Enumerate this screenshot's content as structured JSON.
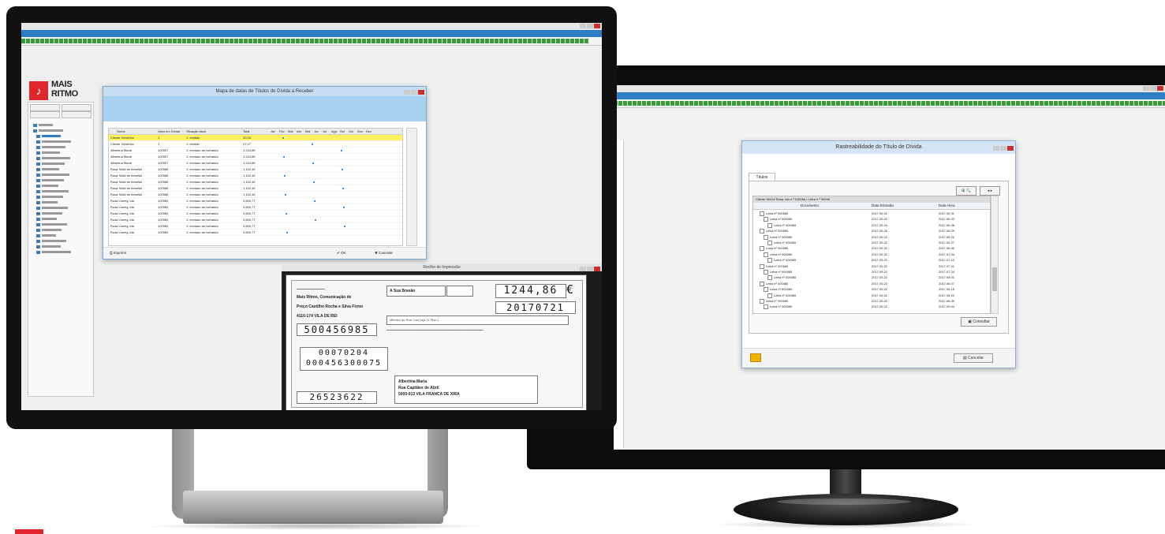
{
  "brand": {
    "logo_line1": "MAIS",
    "logo_line2": "RITMO",
    "accent": "#e0262d",
    "app_blue": "#2f7dc4"
  },
  "left_screen": {
    "grid_dialog": {
      "title": "Mapa de datas de Títulos de Dívida a Receber",
      "columns": [
        "Nome",
        "Valor em Dívida",
        "Situação atual",
        "Total",
        "Jan",
        "Fev",
        "Mar",
        "Abr",
        "Mai",
        "Jun",
        "Jul",
        "Ago",
        "Set",
        "Out",
        "Nov",
        "Dez"
      ],
      "rows": [
        {
          "nome": "Cliente Genérico",
          "valor": "1",
          "situacao": "1. emitido",
          "total": "20,00"
        },
        {
          "nome": "Cliente Genérico",
          "valor": "1",
          "situacao": "1. emitido",
          "total": "27,07"
        },
        {
          "nome": "Albertina Maria",
          "valor": "100957",
          "situacao": "1. enviado ao cobrador",
          "total": "1.244,86"
        },
        {
          "nome": "Albertina Maria",
          "valor": "100957",
          "situacao": "1. enviado ao cobrador",
          "total": "1.244,86"
        },
        {
          "nome": "Albertina Maria",
          "valor": "100957",
          "situacao": "1. enviado ao cobrador",
          "total": "1.244,86"
        },
        {
          "nome": "Rosa Sofia de Almeida",
          "valor": "100968",
          "situacao": "1. enviado ao cobrador",
          "total": "1.152,46"
        },
        {
          "nome": "Rosa Sofia de Almeida",
          "valor": "100968",
          "situacao": "1. enviado ao cobrador",
          "total": "1.152,46"
        },
        {
          "nome": "Rosa Sofia de Almeida",
          "valor": "100968",
          "situacao": "1. enviado ao cobrador",
          "total": "1.152,46"
        },
        {
          "nome": "Rosa Sofia de Almeida",
          "valor": "100968",
          "situacao": "1. enviado ao cobrador",
          "total": "1.152,46"
        },
        {
          "nome": "Rosa Sofia de Almeida",
          "valor": "100968",
          "situacao": "1. enviado ao cobrador",
          "total": "1.152,46"
        },
        {
          "nome": "Rosa Liberty, Ida",
          "valor": "100969",
          "situacao": "1. enviado ao cobrador",
          "total": "3.600,77"
        },
        {
          "nome": "Rosa Liberty, Ida",
          "valor": "100969",
          "situacao": "1. enviado ao cobrador",
          "total": "3.600,77"
        },
        {
          "nome": "Rosa Liberty, Ida",
          "valor": "100969",
          "situacao": "1. enviado ao cobrador",
          "total": "3.600,77"
        },
        {
          "nome": "Rosa Liberty, Ida",
          "valor": "100969",
          "situacao": "1. enviado ao cobrador",
          "total": "3.600,77"
        },
        {
          "nome": "Rosa Liberty, Ida",
          "valor": "100969",
          "situacao": "1. enviado ao cobrador",
          "total": "3.600,77"
        },
        {
          "nome": "Rosa Liberty, Ida",
          "valor": "100969",
          "situacao": "1. enviado ao cobrador",
          "total": "3.600,77"
        }
      ],
      "footer_left": "Imprimir",
      "footer_ok": "OK",
      "footer_cancel": "Cancelar"
    },
    "slip_dialog": {
      "title": "Recibo de Impressão",
      "amount": "1244,86",
      "currency": "€",
      "date": "20170721",
      "payer_company": "Mais Ritmo, Comunicação de",
      "payer_line2": "Preço Castilho Rocha e Silva Firmo",
      "payer_line3": "4110-174 VILA DE REI",
      "account_number": "500456985",
      "ref_line1": "00070204",
      "ref_line2": "000456300075",
      "bottom_number": "26523622",
      "label_vencimento": "A Sua Brasão",
      "debtor_name": "Albertina Maria",
      "debtor_street": "Rua Capitães de Abril",
      "debtor_city": "5000-913 VILA FRANCA DE XIRA",
      "note_line": "Milhões do Rua, Lda Loja 11 Piso 1"
    }
  },
  "right_screen": {
    "dialog": {
      "title": "Rastreabilidade do Título de Dívida",
      "tab": "Títulos",
      "path": "Cliente 00416 Rosa, lda n.º 015268 • Letra n.º 00045",
      "columns": [
        "Documento",
        "Data Emissão",
        "Data Hora"
      ],
      "rows": [
        {
          "doc": "Letra nº 000085",
          "emissao": "2017.05.22",
          "hora": "2017.05.31"
        },
        {
          "doc": "Letra nº 000085",
          "emissao": "2017.05.22",
          "hora": "2017.06.02"
        },
        {
          "doc": "Letra nº 000085",
          "emissao": "2017.05.24",
          "hora": "2017.06.06"
        },
        {
          "doc": "Letra nº 000085",
          "emissao": "2017.05.26",
          "hora": "2017.06.09"
        },
        {
          "doc": "Letra nº 000085",
          "emissao": "2017.05.22",
          "hora": "2017.06.22"
        },
        {
          "doc": "Letra nº 000085",
          "emissao": "2017.05.22",
          "hora": "2017.06.27"
        },
        {
          "doc": "Letra nº 000085",
          "emissao": "2017.05.22",
          "hora": "2017.06.30"
        },
        {
          "doc": "Letra nº 000085",
          "emissao": "2017.05.22",
          "hora": "2017.07.04"
        },
        {
          "doc": "Letra nº 000085",
          "emissao": "2017.05.22",
          "hora": "2017.07.12"
        },
        {
          "doc": "Letra nº 000085",
          "emissao": "2017.05.22",
          "hora": "2017.07.21"
        },
        {
          "doc": "Letra nº 000085",
          "emissao": "2017.05.22",
          "hora": "2017.07.24"
        },
        {
          "doc": "Letra nº 000085",
          "emissao": "2017.05.22",
          "hora": "2017.08.01"
        },
        {
          "doc": "Letra nº 000085",
          "emissao": "2017.05.22",
          "hora": "2017.08.07"
        },
        {
          "doc": "Letra nº 000085",
          "emissao": "2017.05.22",
          "hora": "2017.08.15"
        },
        {
          "doc": "Letra nº 000085",
          "emissao": "2017.05.22",
          "hora": "2017.08.22"
        },
        {
          "doc": "Letra nº 000085",
          "emissao": "2017.05.22",
          "hora": "2017.08.30"
        },
        {
          "doc": "Letra nº 000085",
          "emissao": "2017.05.22",
          "hora": "2017.09.04"
        }
      ],
      "consult_button": "Consultar",
      "close_button": "Cancelar"
    }
  }
}
